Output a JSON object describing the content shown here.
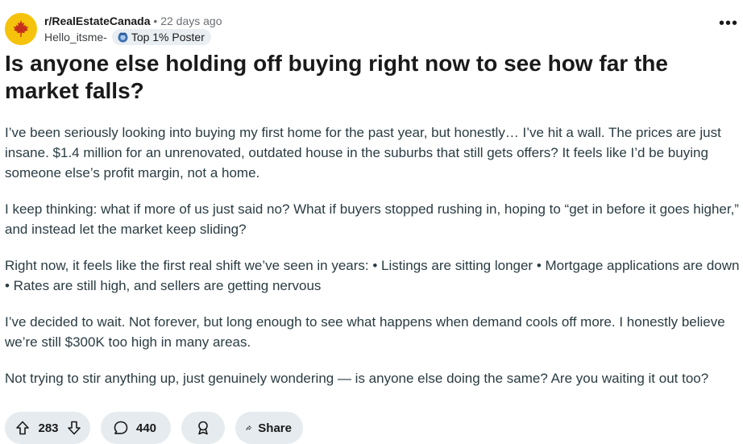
{
  "post": {
    "subreddit": "r/RealEstateCanada",
    "separator": "•",
    "age": "22 days ago",
    "username": "Hello_itsme-",
    "badge": "Top 1% Poster",
    "title": "Is anyone else holding off buying right now to see how far the market falls?",
    "paragraphs": [
      "I’ve been seriously looking into buying my first home for the past year, but honestly… I’ve hit a wall. The prices are just insane. $1.4 million for an unrenovated, outdated house in the suburbs that still gets offers? It feels like I’d be buying someone else’s profit margin, not a home.",
      "I keep thinking: what if more of us just said no? What if buyers stopped rushing in, hoping to “get in before it goes higher,” and instead let the market keep sliding?",
      "Right now, it feels like the first real shift we’ve seen in years: • Listings are sitting longer • Mortgage applications are down • Rates are still high, and sellers are getting nervous",
      "I’ve decided to wait. Not forever, but long enough to see what happens when demand cools off more. I honestly believe we’re still $300K too high in many areas.",
      "Not trying to stir anything up, just genuinely wondering — is anyone else doing the same? Are you waiting it out too?"
    ]
  },
  "actions": {
    "score": "283",
    "comments": "440",
    "share": "Share"
  },
  "icons": {
    "subreddit_avatar": "maple-leaf-icon",
    "more": "more-options-icon",
    "badge": "poster-badge-icon",
    "upvote": "upvote-icon",
    "downvote": "downvote-icon",
    "comment": "comment-icon",
    "award": "award-icon",
    "share": "share-icon"
  },
  "colors": {
    "avatar_bg": "#f5c30b",
    "leaf": "#c6301b",
    "pill_bg": "#e5ebee"
  }
}
